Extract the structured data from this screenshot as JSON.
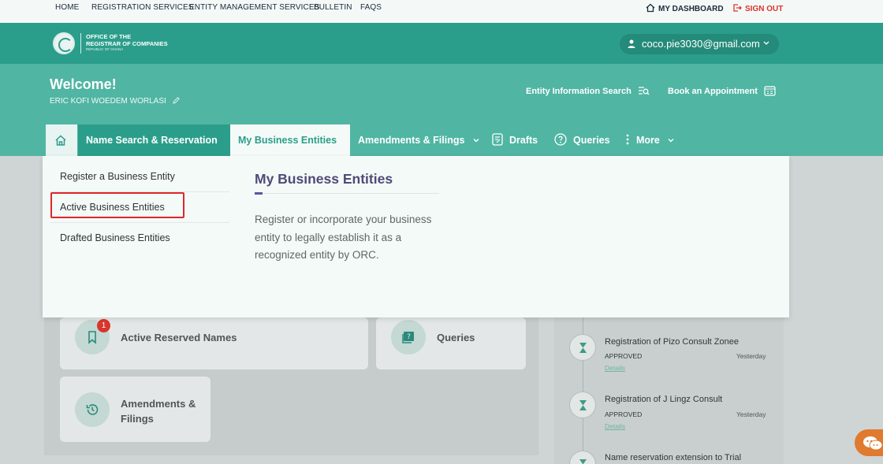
{
  "topnav": {
    "home": "HOME",
    "registration": "REGISTRATION SERVICES",
    "entity_mgmt": "ENTITY MANAGEMENT SERVICES",
    "bulletin": "BULLETIN",
    "faqs": "FAQS",
    "dashboard": "MY DASHBOARD",
    "signout": "SIGN OUT"
  },
  "header": {
    "org_line1": "OFFICE OF THE",
    "org_line2": "REGISTRAR OF COMPANIES",
    "org_line3": "REPUBLIC OF GHANA",
    "user_email": "coco.pie3030@gmail.com"
  },
  "welcome": {
    "title": "Welcome!",
    "user_name": "ERIC KOFI WOEDEM WORLASI",
    "entity_search": "Entity Information Search",
    "appointment": "Book an Appointment"
  },
  "nav": {
    "name_search": "Name Search & Reservation",
    "my_business": "My Business Entities",
    "amendments": "Amendments & Filings",
    "drafts": "Drafts",
    "queries": "Queries",
    "more": "More"
  },
  "dropdown": {
    "items": [
      "Register a Business Entity",
      "Active Business Entities",
      "Drafted Business Entities"
    ],
    "title": "My Business Entities",
    "description": "Register or incorporate your business entity to legally establish it as a recognized entity by ORC."
  },
  "cards": {
    "active_reserved": "Active Reserved Names",
    "active_reserved_badge": "1",
    "queries": "Queries",
    "amendments_line1": "Amendments &",
    "amendments_line2": "Filings"
  },
  "timeline": [
    {
      "title": "Registration of Pizo Consult Zonee",
      "status": "APPROVED",
      "when": "Yesterday",
      "link": "Details"
    },
    {
      "title": "Registration of J Lingz Consult",
      "status": "APPROVED",
      "when": "Yesterday",
      "link": "Details"
    },
    {
      "title": "Name reservation extension to Trial"
    }
  ],
  "colors": {
    "primary_teal": "#2b9e8b",
    "light_teal": "#50b5a3",
    "signout_red": "#d9362b",
    "dropdown_title": "#4f4b78",
    "highlight_red": "#e0262b"
  }
}
